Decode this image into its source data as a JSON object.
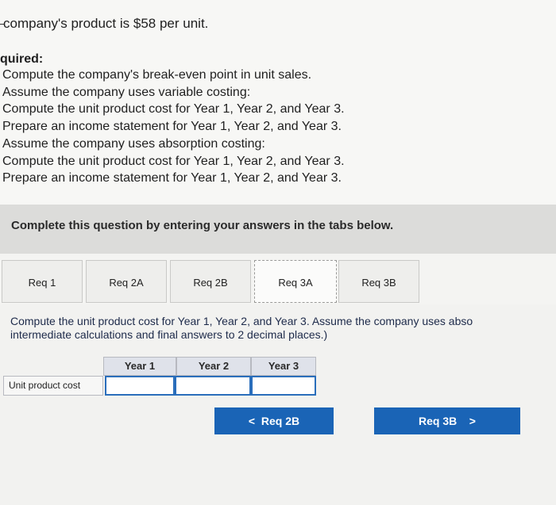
{
  "intro": {
    "line": "company's product is $58 per unit."
  },
  "required": {
    "heading": "quired:",
    "items": [
      "Compute the company's break-even point in unit sales.",
      "Assume the company uses variable costing:",
      "Compute the unit product cost for Year 1, Year 2, and Year 3.",
      "Prepare an income statement for Year 1, Year 2, and Year 3.",
      "Assume the company uses absorption costing:",
      "Compute the unit product cost for Year 1, Year 2, and Year 3.",
      "Prepare an income statement for Year 1, Year 2, and Year 3."
    ]
  },
  "band": {
    "text": "Complete this question by entering your answers in the tabs below."
  },
  "tabs": [
    {
      "label": "Req 1"
    },
    {
      "label": "Req 2A"
    },
    {
      "label": "Req 2B"
    },
    {
      "label": "Req 3A",
      "active": true
    },
    {
      "label": "Req 3B"
    }
  ],
  "instruction": {
    "line1": "Compute the unit product cost for Year 1, Year 2, and Year 3. Assume the company uses abso",
    "line2": "intermediate calculations and final answers to 2 decimal places.)"
  },
  "table": {
    "columns": [
      "Year 1",
      "Year 2",
      "Year 3"
    ],
    "row_label": "Unit product cost",
    "values": [
      "",
      "",
      ""
    ]
  },
  "nav": {
    "prev_label": "Req 2B",
    "prev_icon": "<",
    "next_label": "Req 3B",
    "next_icon": ">"
  },
  "colors": {
    "accent": "#1a64b6",
    "band": "#dcdcda",
    "header_cell": "#dfe2ea"
  }
}
